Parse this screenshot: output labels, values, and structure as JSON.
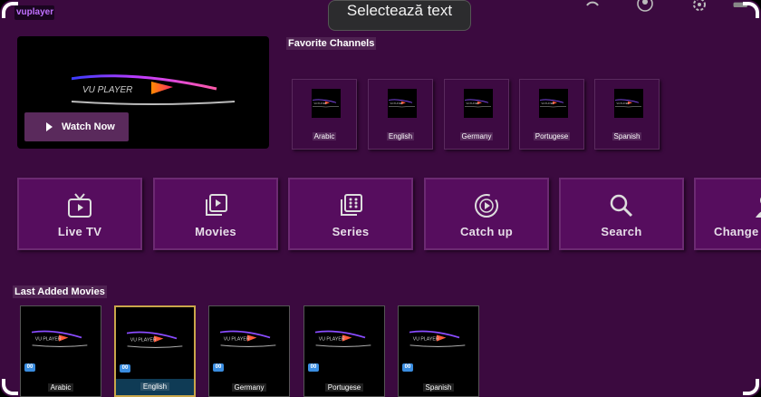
{
  "app": {
    "logo_text": "vuplayer"
  },
  "tooltip": "Selectează text",
  "banner": {
    "watch_label": "Watch Now"
  },
  "favorites": {
    "title": "Favorite Channels",
    "items": [
      "Arabic",
      "English",
      "Germany",
      "Portugese",
      "Spanish"
    ]
  },
  "nav": [
    {
      "label": "Live TV",
      "icon": "tv-icon"
    },
    {
      "label": "Movies",
      "icon": "movies-icon"
    },
    {
      "label": "Series",
      "icon": "series-icon"
    },
    {
      "label": "Catch up",
      "icon": "catchup-icon"
    },
    {
      "label": "Search",
      "icon": "search-icon"
    },
    {
      "label": "Change",
      "icon": "user-icon"
    }
  ],
  "movies": {
    "title": "Last Added Movies",
    "items": [
      {
        "label": "Arabic",
        "badge": "00"
      },
      {
        "label": "English",
        "badge": "00"
      },
      {
        "label": "Germany",
        "badge": "00"
      },
      {
        "label": "Portugese",
        "badge": "00"
      },
      {
        "label": "Spanish",
        "badge": "00"
      }
    ]
  },
  "colors": {
    "background": "#3b0a3f",
    "tile": "#560d5e",
    "selected_border": "#c9a64a",
    "badge": "#3a8de0"
  }
}
